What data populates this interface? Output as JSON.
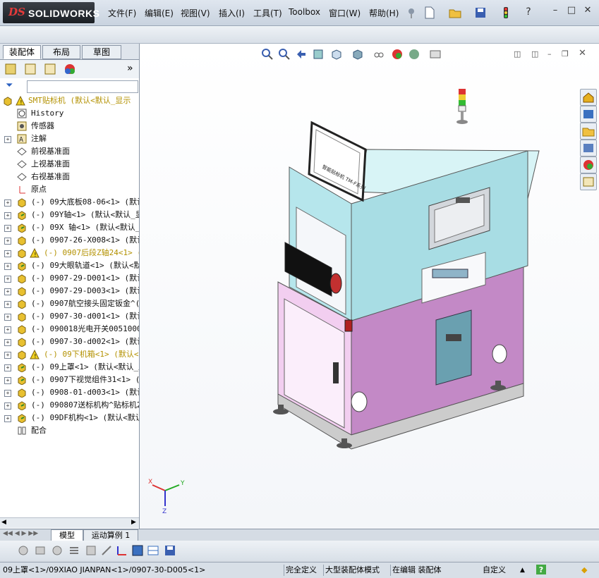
{
  "app": {
    "logo_ds": "DS",
    "logo_name": "SOLIDWORKS"
  },
  "menu": [
    "文件(F)",
    "编辑(E)",
    "视图(V)",
    "插入(I)",
    "工具(T)",
    "Toolbox",
    "窗口(W)",
    "帮助(H)"
  ],
  "tabs": [
    "装配体",
    "布局",
    "草图"
  ],
  "tree": {
    "root": "SMT贴标机  (默认<默认_显示",
    "items": [
      {
        "label": "History",
        "icon": "history-icon",
        "expand": ""
      },
      {
        "label": "传感器",
        "icon": "sensor-icon",
        "expand": ""
      },
      {
        "label": "注解",
        "icon": "annotation-icon",
        "expand": "+"
      },
      {
        "label": "前视基准面",
        "icon": "plane-icon",
        "expand": ""
      },
      {
        "label": "上视基准面",
        "icon": "plane-icon",
        "expand": ""
      },
      {
        "label": "右视基准面",
        "icon": "plane-icon",
        "expand": ""
      },
      {
        "label": "原点",
        "icon": "origin-icon",
        "expand": ""
      },
      {
        "label": "(-) 09大底板08-06<1> (默认",
        "icon": "part-icon",
        "expand": "+"
      },
      {
        "label": "(-) 09Y轴<1> (默认<默认_显",
        "icon": "assembly-icon",
        "expand": "+"
      },
      {
        "label": "(-) 09X 轴<1> (默认<默认_显",
        "icon": "assembly-icon",
        "expand": "+"
      },
      {
        "label": "(-) 0907-26-X008<1> (默认",
        "icon": "part-icon",
        "expand": "+"
      },
      {
        "label": "(-) 0907后段Z轴24<1> (默",
        "icon": "warning-assembly-icon",
        "expand": "+",
        "warn": true
      },
      {
        "label": "(-) 09大眼轨道<1> (默认<默",
        "icon": "assembly-icon",
        "expand": "+"
      },
      {
        "label": "(-) 0907-29-D001<1> (默认",
        "icon": "part-icon",
        "expand": "+"
      },
      {
        "label": "(-) 0907-29-D003<1> (默认",
        "icon": "part-icon",
        "expand": "+"
      },
      {
        "label": "(-) 0907航空接头固定钣金^(",
        "icon": "part-icon",
        "expand": "+"
      },
      {
        "label": "(-) 0907-30-d001<1> (默认",
        "icon": "part-icon",
        "expand": "+"
      },
      {
        "label": "(-) 090018光电开关00510002",
        "icon": "part-icon",
        "expand": "+"
      },
      {
        "label": "(-) 0907-30-d002<1> (默认",
        "icon": "part-icon",
        "expand": "+"
      },
      {
        "label": "(-) 09下机箱<1> (默认<默",
        "icon": "warning-assembly-icon",
        "expand": "+",
        "warn": true
      },
      {
        "label": "(-) 09上罩<1> (默认<默认_显",
        "icon": "assembly-icon",
        "expand": "+"
      },
      {
        "label": "(-) 0907下视觉组件31<1> (",
        "icon": "assembly-icon",
        "expand": "+"
      },
      {
        "label": "(-) 0908-01-d003<1> (默认",
        "icon": "part-icon",
        "expand": "+"
      },
      {
        "label": "(-) 090807送标机构^贴标机2",
        "icon": "assembly-icon",
        "expand": "+"
      },
      {
        "label": "(-) 09DF机构<1> (默认<默认",
        "icon": "assembly-icon",
        "expand": "+"
      },
      {
        "label": "配合",
        "icon": "mates-icon",
        "expand": ""
      }
    ]
  },
  "bottom_tabs": [
    "模型",
    "运动算例 1"
  ],
  "status": {
    "path": "09上罩<1>/09XIAO JIANPAN<1>/0907-30-D005<1>",
    "definition": "完全定义",
    "mode": "大型装配体模式",
    "editing": "在编辑 装配体",
    "custom": "自定义"
  },
  "triad": {
    "x": "X",
    "y": "Y",
    "z": "Z"
  },
  "machine_screen_text": "智能贴标机 TM-F系列"
}
